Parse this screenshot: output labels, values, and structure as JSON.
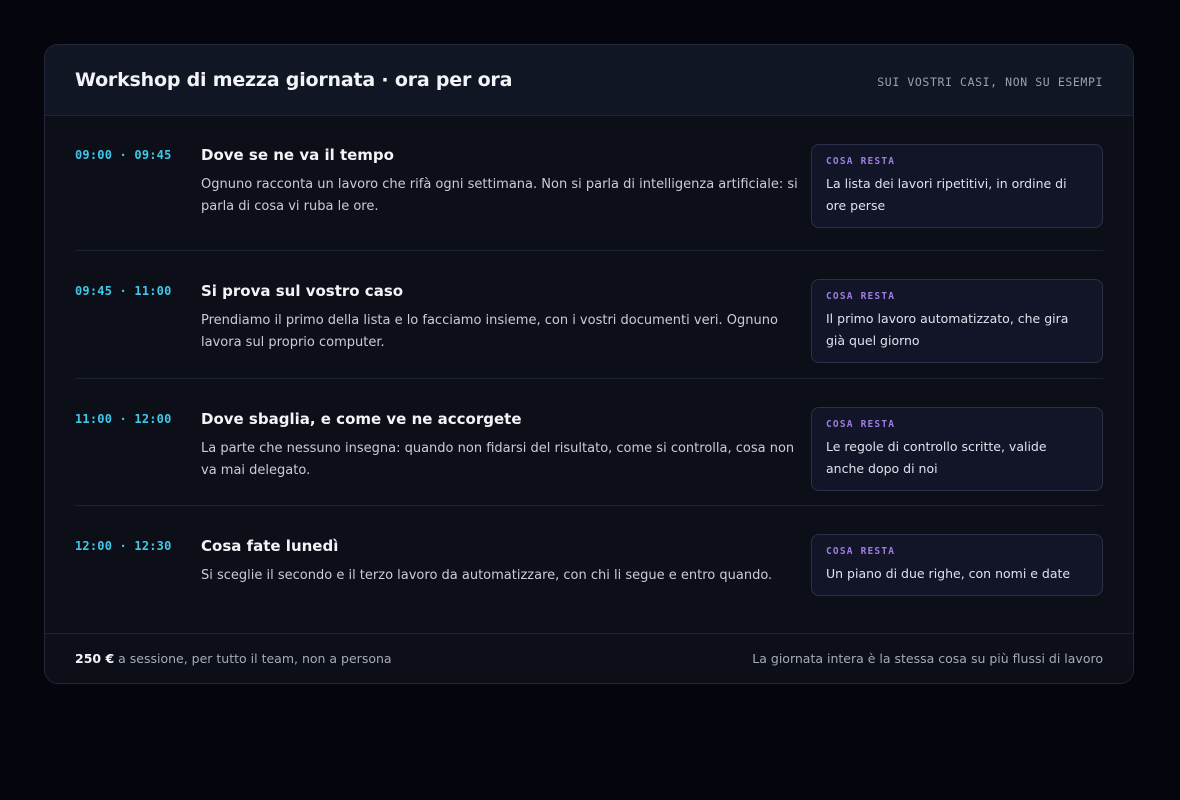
{
  "header": {
    "title": "Workshop di mezza giornata · ora per ora",
    "tagline": "SUI VOSTRI CASI, NON SU ESEMPI"
  },
  "sessions": [
    {
      "time": "09:00 · 09:45",
      "title": "Dove se ne va il tempo",
      "description": "Ognuno racconta un lavoro che rifà ogni settimana. Non si parla di intelligenza artificiale: si parla di cosa vi ruba le ore.",
      "result_label": "COSA RESTA",
      "result": "La lista dei lavori ripetitivi, in ordine di ore perse"
    },
    {
      "time": "09:45 · 11:00",
      "title": "Si prova sul vostro caso",
      "description": "Prendiamo il primo della lista e lo facciamo insieme, con i vostri documenti veri. Ognuno lavora sul proprio computer.",
      "result_label": "COSA RESTA",
      "result": "Il primo lavoro automatizzato, che gira già quel giorno"
    },
    {
      "time": "11:00 · 12:00",
      "title": "Dove sbaglia, e come ve ne accorgete",
      "description": "La parte che nessuno insegna: quando non fidarsi del risultato, come si controlla, cosa non va mai delegato.",
      "result_label": "COSA RESTA",
      "result": "Le regole di controllo scritte, valide anche dopo di noi"
    },
    {
      "time": "12:00 · 12:30",
      "title": "Cosa fate lunedì",
      "description": "Si sceglie il secondo e il terzo lavoro da automatizzare, con chi li segue e entro quando.",
      "result_label": "COSA RESTA",
      "result": "Un piano di due righe, con nomi e date"
    }
  ],
  "footer": {
    "price": "250 €",
    "price_note": " a sessione, per tutto il team, non a persona",
    "right_note": "La giornata intera è la stessa cosa su più flussi di lavoro"
  },
  "colors": {
    "background": "#05060d",
    "card": "#0c0e18",
    "time_accent": "#40c8e8",
    "label_accent": "#9b7fe0"
  }
}
